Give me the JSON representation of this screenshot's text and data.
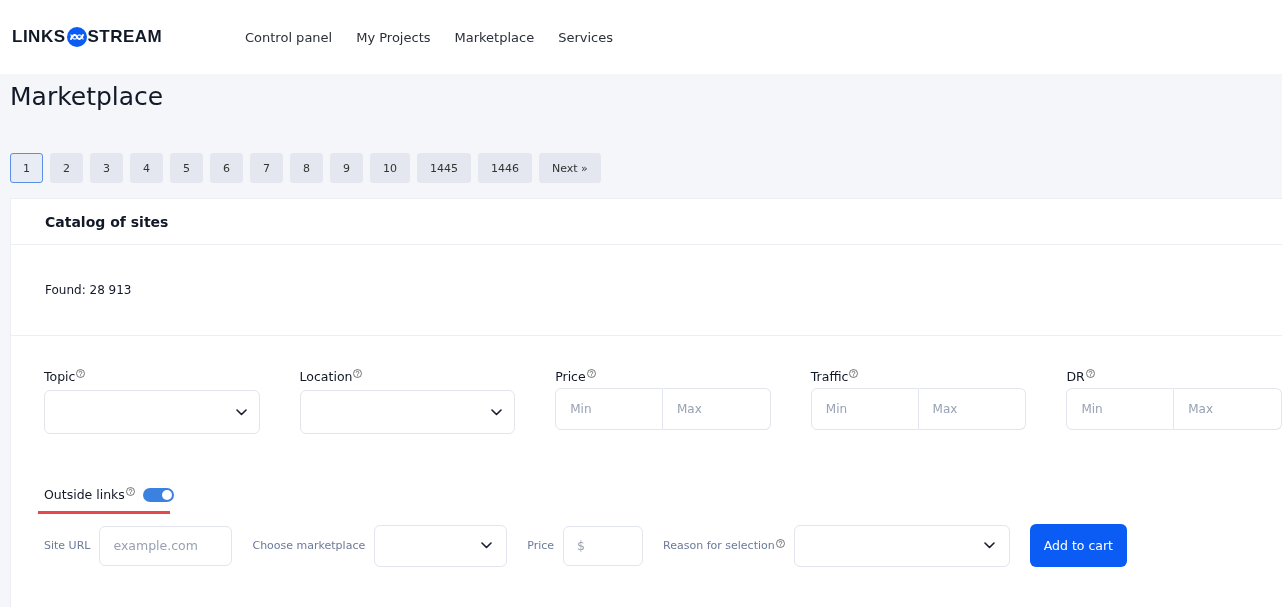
{
  "brand": {
    "left": "LINKS",
    "right": "STREAM"
  },
  "nav": [
    {
      "label": "Control panel"
    },
    {
      "label": "My Projects"
    },
    {
      "label": "Marketplace"
    },
    {
      "label": "Services"
    }
  ],
  "page_title": "Marketplace",
  "pagination": [
    {
      "label": "1",
      "selected": true
    },
    {
      "label": "2",
      "selected": false
    },
    {
      "label": "3",
      "selected": false
    },
    {
      "label": "4",
      "selected": false
    },
    {
      "label": "5",
      "selected": false
    },
    {
      "label": "6",
      "selected": false
    },
    {
      "label": "7",
      "selected": false
    },
    {
      "label": "8",
      "selected": false
    },
    {
      "label": "9",
      "selected": false
    },
    {
      "label": "10",
      "selected": false
    },
    {
      "label": "1445",
      "selected": false
    },
    {
      "label": "1446",
      "selected": false
    },
    {
      "label": "Next »",
      "selected": false
    }
  ],
  "catalog": {
    "title": "Catalog of sites",
    "found": "Found: 28 913",
    "filters": [
      {
        "kind": "select",
        "label": "Topic",
        "help": true
      },
      {
        "kind": "select",
        "label": "Location",
        "help": true
      },
      {
        "kind": "range",
        "label": "Price",
        "help": true,
        "min_placeholder": "Min",
        "max_placeholder": "Max"
      },
      {
        "kind": "range",
        "label": "Traffic",
        "help": true,
        "min_placeholder": "Min",
        "max_placeholder": "Max"
      },
      {
        "kind": "range",
        "label": "DR",
        "help": true,
        "min_placeholder": "Min",
        "max_placeholder": "Max"
      }
    ],
    "outside_links": {
      "label": "Outside links",
      "help": true,
      "on": true,
      "highlighted": true
    },
    "add_form": {
      "fields": [
        {
          "kind": "input",
          "label": "Site URL",
          "help": false,
          "placeholder": "example.com"
        },
        {
          "kind": "select",
          "label": "Choose marketplace",
          "help": false
        },
        {
          "kind": "input",
          "label": "Price",
          "help": false,
          "placeholder": "$"
        },
        {
          "kind": "select",
          "label": "Reason for selection",
          "help": true
        }
      ],
      "button": "Add to cart"
    }
  }
}
